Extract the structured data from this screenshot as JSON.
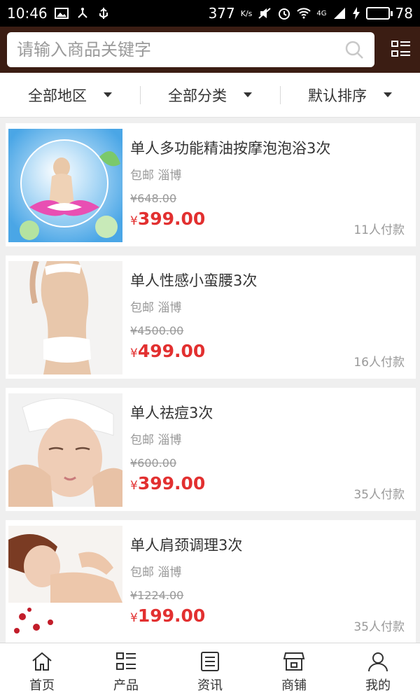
{
  "status_bar": {
    "time": "10:46",
    "network_speed": "377",
    "speed_unit": "K/s",
    "signal_label": "4G",
    "battery": "78",
    "battery_level": 0.78
  },
  "search": {
    "placeholder": "请输入商品关键字"
  },
  "filters": [
    {
      "label": "全部地区"
    },
    {
      "label": "全部分类"
    },
    {
      "label": "默认排序"
    }
  ],
  "products": [
    {
      "title": "单人多功能精油按摩泡泡浴3次",
      "sub": "包邮 淄博",
      "old_price": "¥648.00",
      "currency": "¥",
      "price": "399.00",
      "sold": "11人付款"
    },
    {
      "title": "单人性感小蛮腰3次",
      "sub": "包邮 淄博",
      "old_price": "¥4500.00",
      "currency": "¥",
      "price": "499.00",
      "sold": "16人付款"
    },
    {
      "title": "单人祛痘3次",
      "sub": "包邮 淄博",
      "old_price": "¥600.00",
      "currency": "¥",
      "price": "399.00",
      "sold": "35人付款"
    },
    {
      "title": "单人肩颈调理3次",
      "sub": "包邮 淄博",
      "old_price": "¥1224.00",
      "currency": "¥",
      "price": "199.00",
      "sold": "35人付款"
    }
  ],
  "nav": [
    {
      "label": "首页",
      "icon": "home-icon"
    },
    {
      "label": "产品",
      "icon": "list-icon"
    },
    {
      "label": "资讯",
      "icon": "news-icon"
    },
    {
      "label": "商铺",
      "icon": "store-icon"
    },
    {
      "label": "我的",
      "icon": "user-icon"
    }
  ],
  "colors": {
    "header_bg": "#3b1d13",
    "price": "#e23030",
    "battery": "#3bd34a"
  }
}
